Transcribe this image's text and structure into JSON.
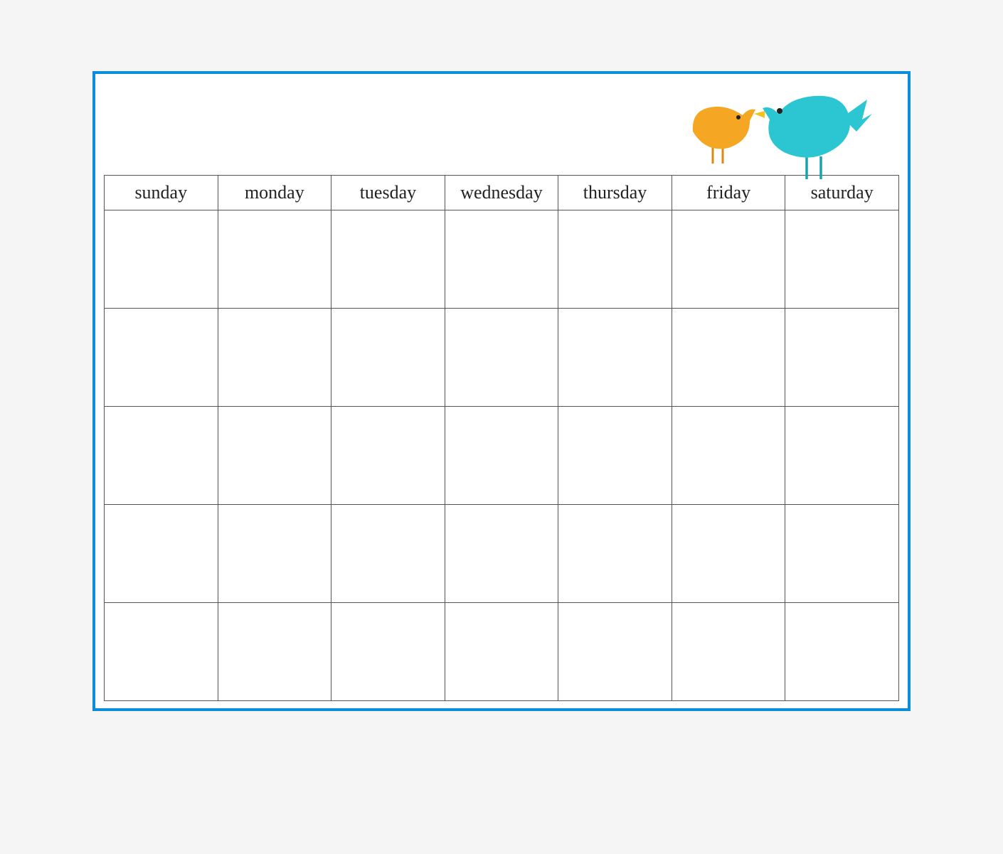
{
  "calendar": {
    "days": [
      "sunday",
      "monday",
      "tuesday",
      "wednesday",
      "thursday",
      "friday",
      "saturday"
    ],
    "weeks": 5
  },
  "colors": {
    "frame_border": "#0a8ed9",
    "grid_line": "#545454",
    "bird_orange": "#f5a623",
    "bird_teal": "#2cc6d2",
    "bird_beak": "#f0c419",
    "bird_leg_orange": "#d88a16",
    "bird_leg_teal": "#1aa3ad"
  }
}
